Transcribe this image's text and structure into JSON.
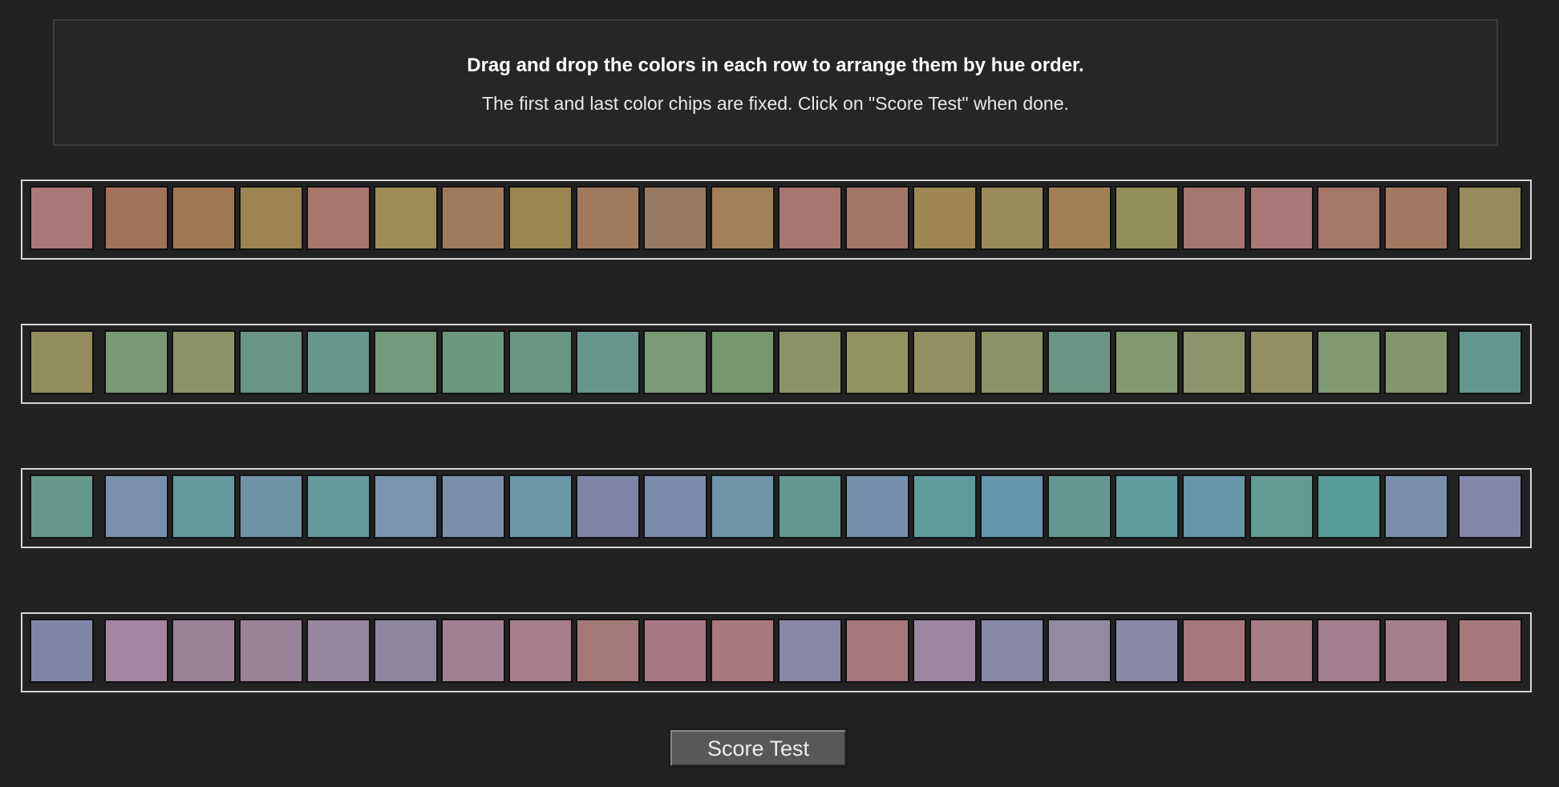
{
  "instructions": {
    "title": "Drag and drop the colors in each row to arrange them by hue order.",
    "subtitle": "The first and last color chips are fixed. Click on \"Score Test\" when done."
  },
  "score_button": {
    "label": "Score Test"
  },
  "rows": [
    {
      "name": "row-1",
      "chips": [
        "#ab787a",
        "#a2725d",
        "#a07853",
        "#9e8352",
        "#a7766c",
        "#9e8c59",
        "#a07a5c",
        "#998650",
        "#a07a5f",
        "#977a63",
        "#a17f59",
        "#a87670",
        "#a47569",
        "#9f8655",
        "#9a8c5a",
        "#a17f55",
        "#928e58",
        "#a57670",
        "#a97778",
        "#a5766a",
        "#a37862",
        "#948c5b"
      ]
    },
    {
      "name": "row-2",
      "chips": [
        "#938c5b",
        "#7a9977",
        "#8a9468",
        "#6a9485",
        "#66978c",
        "#739a7b",
        "#6b9880",
        "#6a9583",
        "#65968c",
        "#7c9a75",
        "#76976f",
        "#8a9466",
        "#919361",
        "#928f60",
        "#899365",
        "#6a9483",
        "#82996f",
        "#8c946a",
        "#939164",
        "#809971",
        "#84966c",
        "#63978e"
      ]
    },
    {
      "name": "row-3",
      "chips": [
        "#65978a",
        "#7b90aa",
        "#64999c",
        "#6e93a5",
        "#659a9b",
        "#7a93ae",
        "#7b8faa",
        "#6a97a6",
        "#7c85a6",
        "#7c8aab",
        "#6d95a5",
        "#63978f",
        "#748eab",
        "#5f9a9c",
        "#6396ab",
        "#64978f",
        "#5f9a9d",
        "#6496a6",
        "#649a94",
        "#599c96",
        "#7a8fab",
        "#8587a8"
      ]
    },
    {
      "name": "row-4",
      "chips": [
        "#8087a6",
        "#a2859e",
        "#9b8299",
        "#998398",
        "#97869d",
        "#8e879e",
        "#a08191",
        "#a57e8a",
        "#a57878",
        "#a87884",
        "#a7787d",
        "#8887a5",
        "#a5767c",
        "#9a869f",
        "#8787a6",
        "#928a9f",
        "#8888a6",
        "#a5777c",
        "#a67c85",
        "#a47d8e",
        "#a4808e",
        "#a7787a"
      ]
    }
  ]
}
